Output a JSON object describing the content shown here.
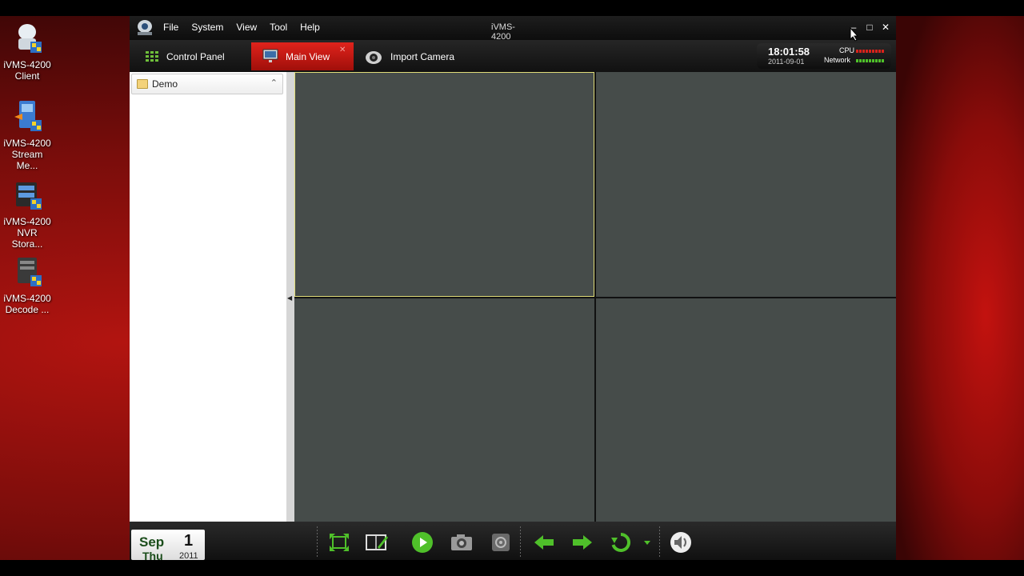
{
  "desktop": {
    "icons": [
      {
        "line1": "iVMS-4200",
        "line2": "Client"
      },
      {
        "line1": "iVMS-4200",
        "line2": "Stream Me..."
      },
      {
        "line1": "iVMS-4200",
        "line2": "NVR Stora..."
      },
      {
        "line1": "iVMS-4200",
        "line2": "Decode ..."
      }
    ]
  },
  "window": {
    "title": "iVMS-4200",
    "menu": [
      "File",
      "System",
      "View",
      "Tool",
      "Help"
    ],
    "controls": {
      "minimize": "–",
      "maximize": "□",
      "close": "✕"
    }
  },
  "tabs": [
    {
      "label": "Control Panel",
      "icon": "grid-icon",
      "active": false
    },
    {
      "label": "Main View",
      "icon": "monitor-icon",
      "active": true,
      "closable": true
    },
    {
      "label": "Import Camera",
      "icon": "camera-icon",
      "active": false
    }
  ],
  "status": {
    "time": "18:01:58",
    "date": "2011-09-01",
    "cpu_label": "CPU",
    "network_label": "Network"
  },
  "tree": {
    "root_label": "Demo"
  },
  "layout": {
    "grid": "2x2",
    "selected_cell": 1
  },
  "calendar": {
    "month": "Sep",
    "day": "1",
    "weekday": "Thu",
    "year": "2011"
  },
  "toolbar_icons": [
    "fullscreen-icon",
    "layout-edit-icon",
    "play-icon",
    "snapshot-icon",
    "record-icon",
    "previous-icon",
    "next-icon",
    "refresh-icon",
    "dropdown-icon",
    "volume-icon"
  ],
  "colors": {
    "accent_red": "#d8231b",
    "video_cell": "#464c4a",
    "selected_border": "#e0dd7a",
    "play_green": "#4fc02a"
  }
}
